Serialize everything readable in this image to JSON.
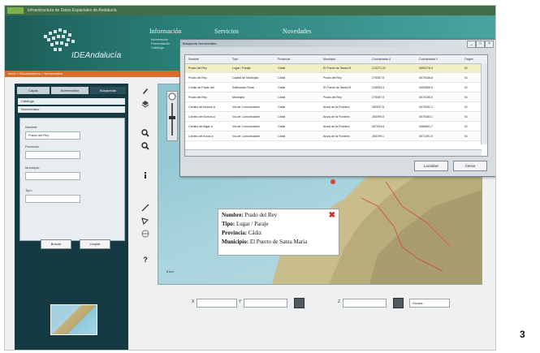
{
  "window": {
    "title": "Infraestructura de Datos Espaciales de Andalucía"
  },
  "brand": {
    "name": "IDEAndalucía"
  },
  "menu": {
    "items": [
      {
        "label": "Información",
        "sub": [
          "Información",
          "Presentación",
          "Catálogo"
        ]
      },
      {
        "label": "Servicios",
        "sub": []
      },
      {
        "label": "Novedades",
        "sub": []
      }
    ]
  },
  "breadcrumb": {
    "text": "Inicio > Visualizadores > Nomenclátor"
  },
  "left_panel": {
    "tabs": [
      "Capas",
      "Nomenclátor",
      "Búsquedas"
    ],
    "active_tab": 2,
    "rows": [
      "Catálogo",
      "Nomenclátor"
    ],
    "fields": [
      {
        "label": "Nombre:",
        "value": "Prado del Rey"
      },
      {
        "label": "Provincia:",
        "value": ""
      },
      {
        "label": "Municipio:",
        "value": ""
      },
      {
        "label": "Tipo:",
        "value": ""
      }
    ],
    "buttons": {
      "search": "Buscar",
      "clear": "Limpiar"
    }
  },
  "tools": {
    "icons": [
      "pencil-icon",
      "layers-icon",
      "zoom-in-icon",
      "zoom-out-icon",
      "info-icon",
      "measure-line-icon",
      "measure-area-icon",
      "globe-icon",
      "help-icon"
    ],
    "help_glyph": "?"
  },
  "map": {
    "scale_label": "5 km"
  },
  "popup": {
    "fields": [
      {
        "key": "Nombre:",
        "value": "Prado del Rey"
      },
      {
        "key": "Tipo:",
        "value": "Lugar / Paraje"
      },
      {
        "key": "Provincia:",
        "value": "Cádiz"
      },
      {
        "key": "Municipio:",
        "value": "El Puerto de Santa María"
      }
    ],
    "close_glyph": "✖"
  },
  "coord_bar": {
    "x_label": "X",
    "y_label": "Y",
    "z_label": "Z",
    "select_value": "-Escala-"
  },
  "dialog": {
    "title": "Búsqueda Nomenclátor",
    "columns": [
      "Nombre",
      "Tipo",
      "Provincia",
      "Municipio",
      "Coordenada X",
      "Coordenada Y",
      "Origen"
    ],
    "rows": [
      [
        "Prado del Rey",
        "Lugar / Paraje",
        "Cádiz",
        "El Puerto de Santa M",
        "213271,31",
        "4053178,4",
        "IG"
      ],
      [
        "Prado del Rey",
        "Capital de Municipio",
        "Cádiz",
        "Prado del Rey",
        "275357,8",
        "4075446,8",
        "IG"
      ],
      [
        "Cortijo de Prado del",
        "Edificación Rural",
        "Cádiz",
        "El Puerto de Santa M",
        "218054,9",
        "4053899,9",
        "IG"
      ],
      [
        "Prado del Rey",
        "Municipio",
        "Cádiz",
        "Prado del Rey",
        "275497,5",
        "4074155,5",
        "IG"
      ],
      [
        "Camino de Bornos a",
        "Vía de Comunicación",
        "Cádiz",
        "Arcos de la Frontera",
        "262537,5",
        "4070092,1",
        "IG"
      ],
      [
        "Camino de Bornos a",
        "Vía de Comunicación",
        "Cádiz",
        "Arcos de la Frontera",
        "263499,5",
        "4070384,1",
        "IG"
      ],
      [
        "Camino de Algar a",
        "Vía de Comunicación",
        "Cádiz",
        "Arcos de la Frontera",
        "267094,8",
        "4069601,7",
        "IG"
      ],
      [
        "Camino de Arcos a",
        "Vía de Comunicación",
        "Cádiz",
        "Arcos de la Frontera",
        "263199,1",
        "4071391,5",
        "IG"
      ]
    ],
    "buttons": {
      "locate": "Localizar",
      "close": "Cerrar"
    },
    "window_controls": [
      "_",
      "□",
      "×"
    ]
  },
  "page_number": "3",
  "colors": {
    "banner": "#2a7f78",
    "orange_bar": "#d76c2b",
    "panel": "#163a44",
    "popup_close": "#d32c1f"
  }
}
